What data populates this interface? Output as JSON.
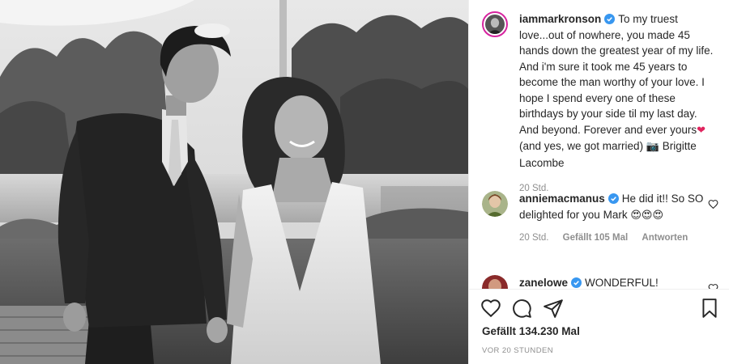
{
  "photo": {
    "alt_subject": "wedding-photo"
  },
  "caption": {
    "username": "iammarkronson",
    "verified": true,
    "text": "To my truest love...out of nowhere, you made 45 hands down the greatest year of my life. And i'm sure it took me 45 years to become the man worthy of your love. I hope I spend every one of these birthdays by your side til my last day. And beyond. Forever and ever yours",
    "heart_emoji": "❤",
    "text_after": "(and yes, we got married)",
    "camera_emoji": "📷",
    "credit": "Brigitte Lacombe",
    "time": "20 Std."
  },
  "comments": [
    {
      "username": "anniemacmanus",
      "verified": true,
      "text": "He did it!! So SO delighted for you Mark",
      "emojis": "😍😍😍",
      "time": "20 Std.",
      "likes": "Gefällt 105 Mal",
      "reply": "Antworten"
    },
    {
      "username": "zanelowe",
      "verified": true,
      "text": "WONDERFUL!"
    }
  ],
  "actions": {
    "likes": "Gefällt 134.230 Mal",
    "posted": "VOR 20 STUNDEN"
  },
  "colors": {
    "verified": "#3897f0",
    "text": "#262626",
    "muted": "#8e8e8e",
    "story_ring": "#d6249f"
  }
}
